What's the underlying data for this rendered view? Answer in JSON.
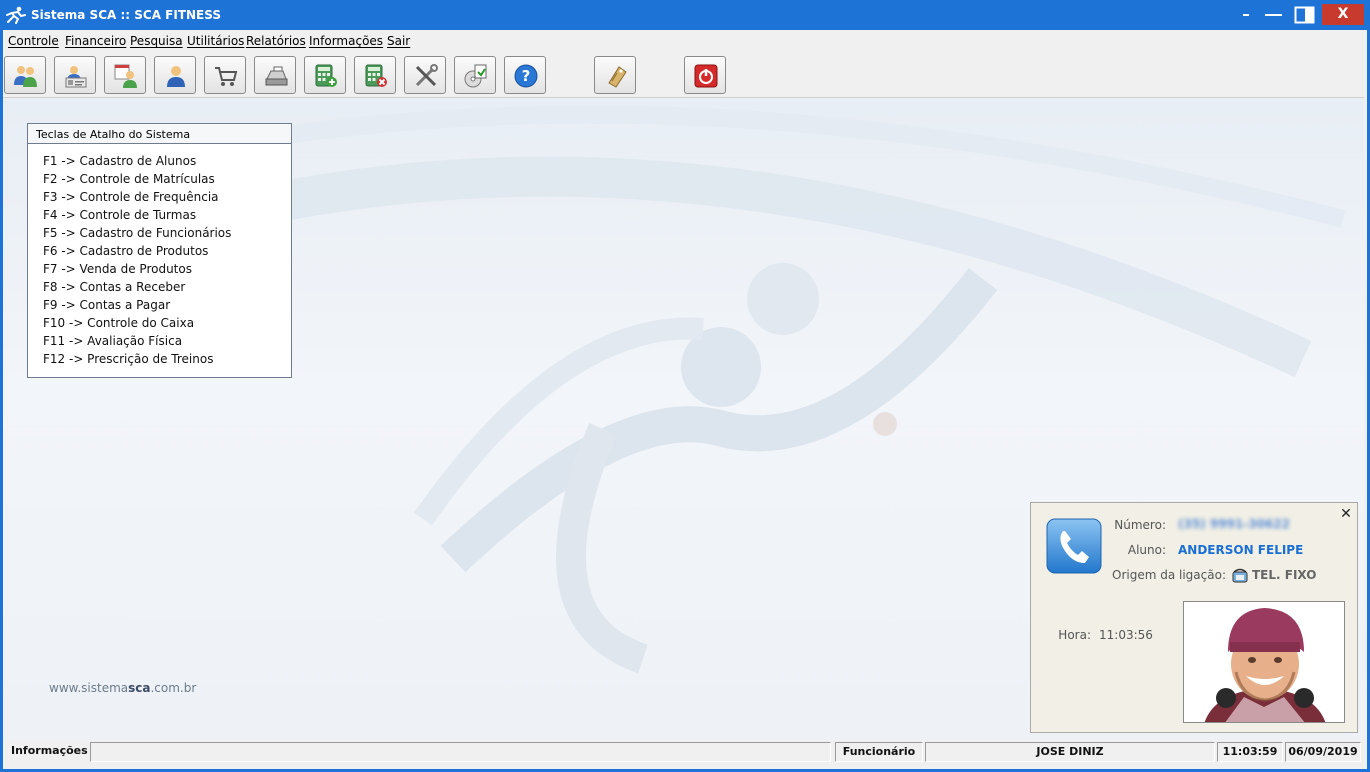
{
  "window": {
    "title": "Sistema SCA :: SCA FITNESS",
    "close_label": "X"
  },
  "menu": [
    {
      "label": "Controle"
    },
    {
      "label": "Financeiro"
    },
    {
      "label": "Pesquisa"
    },
    {
      "label": "Utilitários"
    },
    {
      "label": "Relatórios"
    },
    {
      "label": "Informações"
    },
    {
      "label": "Sair"
    }
  ],
  "toolbar": {
    "buttons": [
      {
        "icon": "students-icon"
      },
      {
        "icon": "enrollment-card-icon"
      },
      {
        "icon": "schedule-user-icon"
      },
      {
        "icon": "user-icon"
      },
      {
        "icon": "shopping-cart-icon"
      },
      {
        "icon": "cash-register-icon"
      },
      {
        "icon": "calculator-add-icon"
      },
      {
        "icon": "calculator-remove-icon"
      },
      {
        "icon": "tools-icon"
      },
      {
        "icon": "backup-disk-icon"
      },
      {
        "icon": "help-icon"
      },
      {
        "icon": "key-tag-icon"
      },
      {
        "icon": "power-icon"
      }
    ]
  },
  "shortcuts": {
    "header": "Teclas de Atalho do Sistema",
    "items": [
      "F1 -> Cadastro de Alunos",
      "F2 -> Controle de Matrículas",
      "F3 -> Controle de Frequência",
      "F4 -> Controle de Turmas",
      "F5 -> Cadastro de Funcionários",
      "F6 -> Cadastro de Produtos",
      "F7 -> Venda de Produtos",
      "F8 -> Contas a Receber",
      "F9 -> Contas a Pagar",
      "F10 -> Controle do Caixa",
      "F11 -> Avaliação Física",
      "F12 -> Prescrição de Treinos"
    ]
  },
  "website": {
    "prefix": "www.sistema",
    "brand": "sca",
    "suffix": ".com.br"
  },
  "caller": {
    "number_label": "Número:",
    "number_value": "(35) 9991-30622",
    "student_label": "Aluno:",
    "student_value": "ANDERSON FELIPE",
    "origin_label": "Origem da ligação:",
    "origin_value": "TEL. FIXO",
    "time_label": "Hora:",
    "time_value": "11:03:56",
    "close_glyph": "✕"
  },
  "statusbar": {
    "info_label": "Informações",
    "employee_label": "Funcionário",
    "employee_value": "JOSE DINIZ",
    "clock": "11:03:59",
    "date": "06/09/2019"
  },
  "colors": {
    "titlebar": "#1e73d6",
    "close": "#c73a2d",
    "student_name": "#1a6fd4"
  }
}
